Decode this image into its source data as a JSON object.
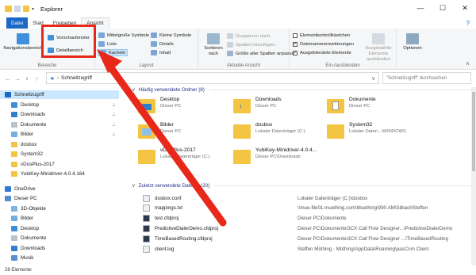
{
  "window": {
    "title": "Explorer",
    "minimize": "—",
    "maximize": "☐",
    "close": "✕"
  },
  "tabs": [
    {
      "label": "Datei"
    },
    {
      "label": "Start"
    },
    {
      "label": "Freigeben"
    },
    {
      "label": "Ansicht"
    }
  ],
  "help_label": "?",
  "ribbon": {
    "panes": {
      "navigation_pane": "Navigationsbereich",
      "preview_pane": "Vorschaufenster",
      "details_pane": "Detailbereich",
      "label": "Bereiche"
    },
    "layout": {
      "label": "Layout",
      "medium_icons": "Mittelgroße Symbole",
      "small_icons": "Kleine Symbole",
      "list": "Liste",
      "details": "Details",
      "tiles": "Kacheln",
      "content": "Inhalt"
    },
    "current_view": {
      "label": "Aktuelle Ansicht",
      "sort_by": "Sortieren nach",
      "group_by": "Gruppieren nach",
      "add_columns": "Spalten hinzufügen",
      "size_all_columns": "Größe aller Spalten anpassen"
    },
    "show_hide": {
      "label": "Ein-/ausblenden",
      "item_checkboxes": "Elementkontrollkästchen",
      "file_name_extensions": "Dateinamenerweiterungen",
      "hidden_items": "Ausgeblendete Elemente",
      "hide_selected": "Ausgewählte Elemente ausblenden",
      "item_checkboxes_checked": false,
      "file_name_extensions_checked": true,
      "hidden_items_checked": true
    },
    "options": {
      "label": "Optionen"
    }
  },
  "address": {
    "path": "Schnellzugriff",
    "search_placeholder": "\"Schnellzugriff\" durchsuchen",
    "back": "←",
    "forward": "→",
    "up": "↑",
    "dropdown": "∨",
    "separator": "›"
  },
  "nav_items": [
    {
      "label": "Schnellzugriff",
      "icon": "star-icon",
      "selected": true,
      "pinned": false
    },
    {
      "label": "Desktop",
      "icon": "desktop-icon",
      "pinned": true
    },
    {
      "label": "Downloads",
      "icon": "downloads-icon",
      "pinned": true
    },
    {
      "label": "Dokumente",
      "icon": "documents-icon",
      "pinned": true
    },
    {
      "label": "Bilder",
      "icon": "pictures-icon",
      "pinned": true
    },
    {
      "label": "dosbox",
      "icon": "folder-icon",
      "pinned": false
    },
    {
      "label": "System32",
      "icon": "folder-icon",
      "pinned": false
    },
    {
      "label": "vDosPlus-2017",
      "icon": "folder-icon",
      "pinned": false
    },
    {
      "label": "YubiKey-Minidriver-4.0.4.164",
      "icon": "folder-icon",
      "pinned": false
    },
    {
      "label": "OneDrive",
      "icon": "cloud-icon",
      "pinned": false
    },
    {
      "label": "Dieser PC",
      "icon": "computer-icon",
      "pinned": false
    },
    {
      "label": "3D-Objekte",
      "icon": "3d-objects-icon",
      "pinned": false
    },
    {
      "label": "Bilder",
      "icon": "pictures-icon",
      "pinned": false
    },
    {
      "label": "Desktop",
      "icon": "desktop-icon",
      "pinned": false
    },
    {
      "label": "Dokumente",
      "icon": "documents-icon",
      "pinned": false
    },
    {
      "label": "Downloads",
      "icon": "downloads-icon",
      "pinned": false
    },
    {
      "label": "Musik",
      "icon": "music-icon",
      "pinned": false
    }
  ],
  "pin_glyph": "📌",
  "sections": {
    "frequent": "Häufig verwendete Ordner (8)",
    "recent": "Zuletzt verwendete Dateien (20)"
  },
  "folders": [
    {
      "name": "Desktop",
      "sub": "Dieser PC",
      "icon": "desktop-folder-icon"
    },
    {
      "name": "Downloads",
      "sub": "Dieser PC",
      "icon": "downloads-folder-icon"
    },
    {
      "name": "Dokumente",
      "sub": "Dieser PC",
      "icon": "documents-folder-icon"
    },
    {
      "name": "Bilder",
      "sub": "Dieser PC",
      "icon": "pictures-folder-icon"
    },
    {
      "name": "dosbox",
      "sub": "Lokaler Datenträger (C:)",
      "icon": "folder-icon"
    },
    {
      "name": "System32",
      "sub": "Lokaler Daten...\\WINDOWS",
      "icon": "folder-icon"
    },
    {
      "name": "vDosPlus-2017",
      "sub": "Lokaler Datenträger (C:)",
      "icon": "folder-icon"
    },
    {
      "name": "YubiKey-Minidriver-4.0.4...",
      "sub": "Dieser PC\\Downloads",
      "icon": "folder-icon"
    }
  ],
  "recent_files": [
    {
      "name": "dosbox.conf",
      "path": "Lokaler Datenträger (C:)\\dosbox",
      "icon": "config-file-icon"
    },
    {
      "name": "mappings.txt",
      "path": "\\\\mue-file01.muething.com\\Muething\\990 AM\\SilbachSteffen",
      "icon": "text-file-icon"
    },
    {
      "name": "test.cfdproj",
      "path": "Dieser PC\\Dokumente",
      "icon": "cfd-project-icon"
    },
    {
      "name": "PredictiveDialerDemo.cfdproj",
      "path": "Dieser PC\\Dokumente\\3CX Call Flow Designer...\\PredictiveDialerDemo",
      "icon": "cfd-project-icon"
    },
    {
      "name": "TimeBasedRouting.cfdproj",
      "path": "Dieser PC\\Dokumente\\3CX Call Flow Designer ...\\TimeBasedRouting",
      "icon": "cfd-project-icon"
    },
    {
      "name": "client.log",
      "path": "Steffen Müthing - Müthing\\AppData\\Roaming\\pasCom Client",
      "icon": "log-file-icon"
    }
  ],
  "status": {
    "count": "28 Elemente"
  },
  "colors": {
    "accent": "#1a68c8",
    "selection": "#cce8ff",
    "highlight_box": "#e8281a",
    "arrow": "#e8281a",
    "folder": "#f4c542"
  }
}
